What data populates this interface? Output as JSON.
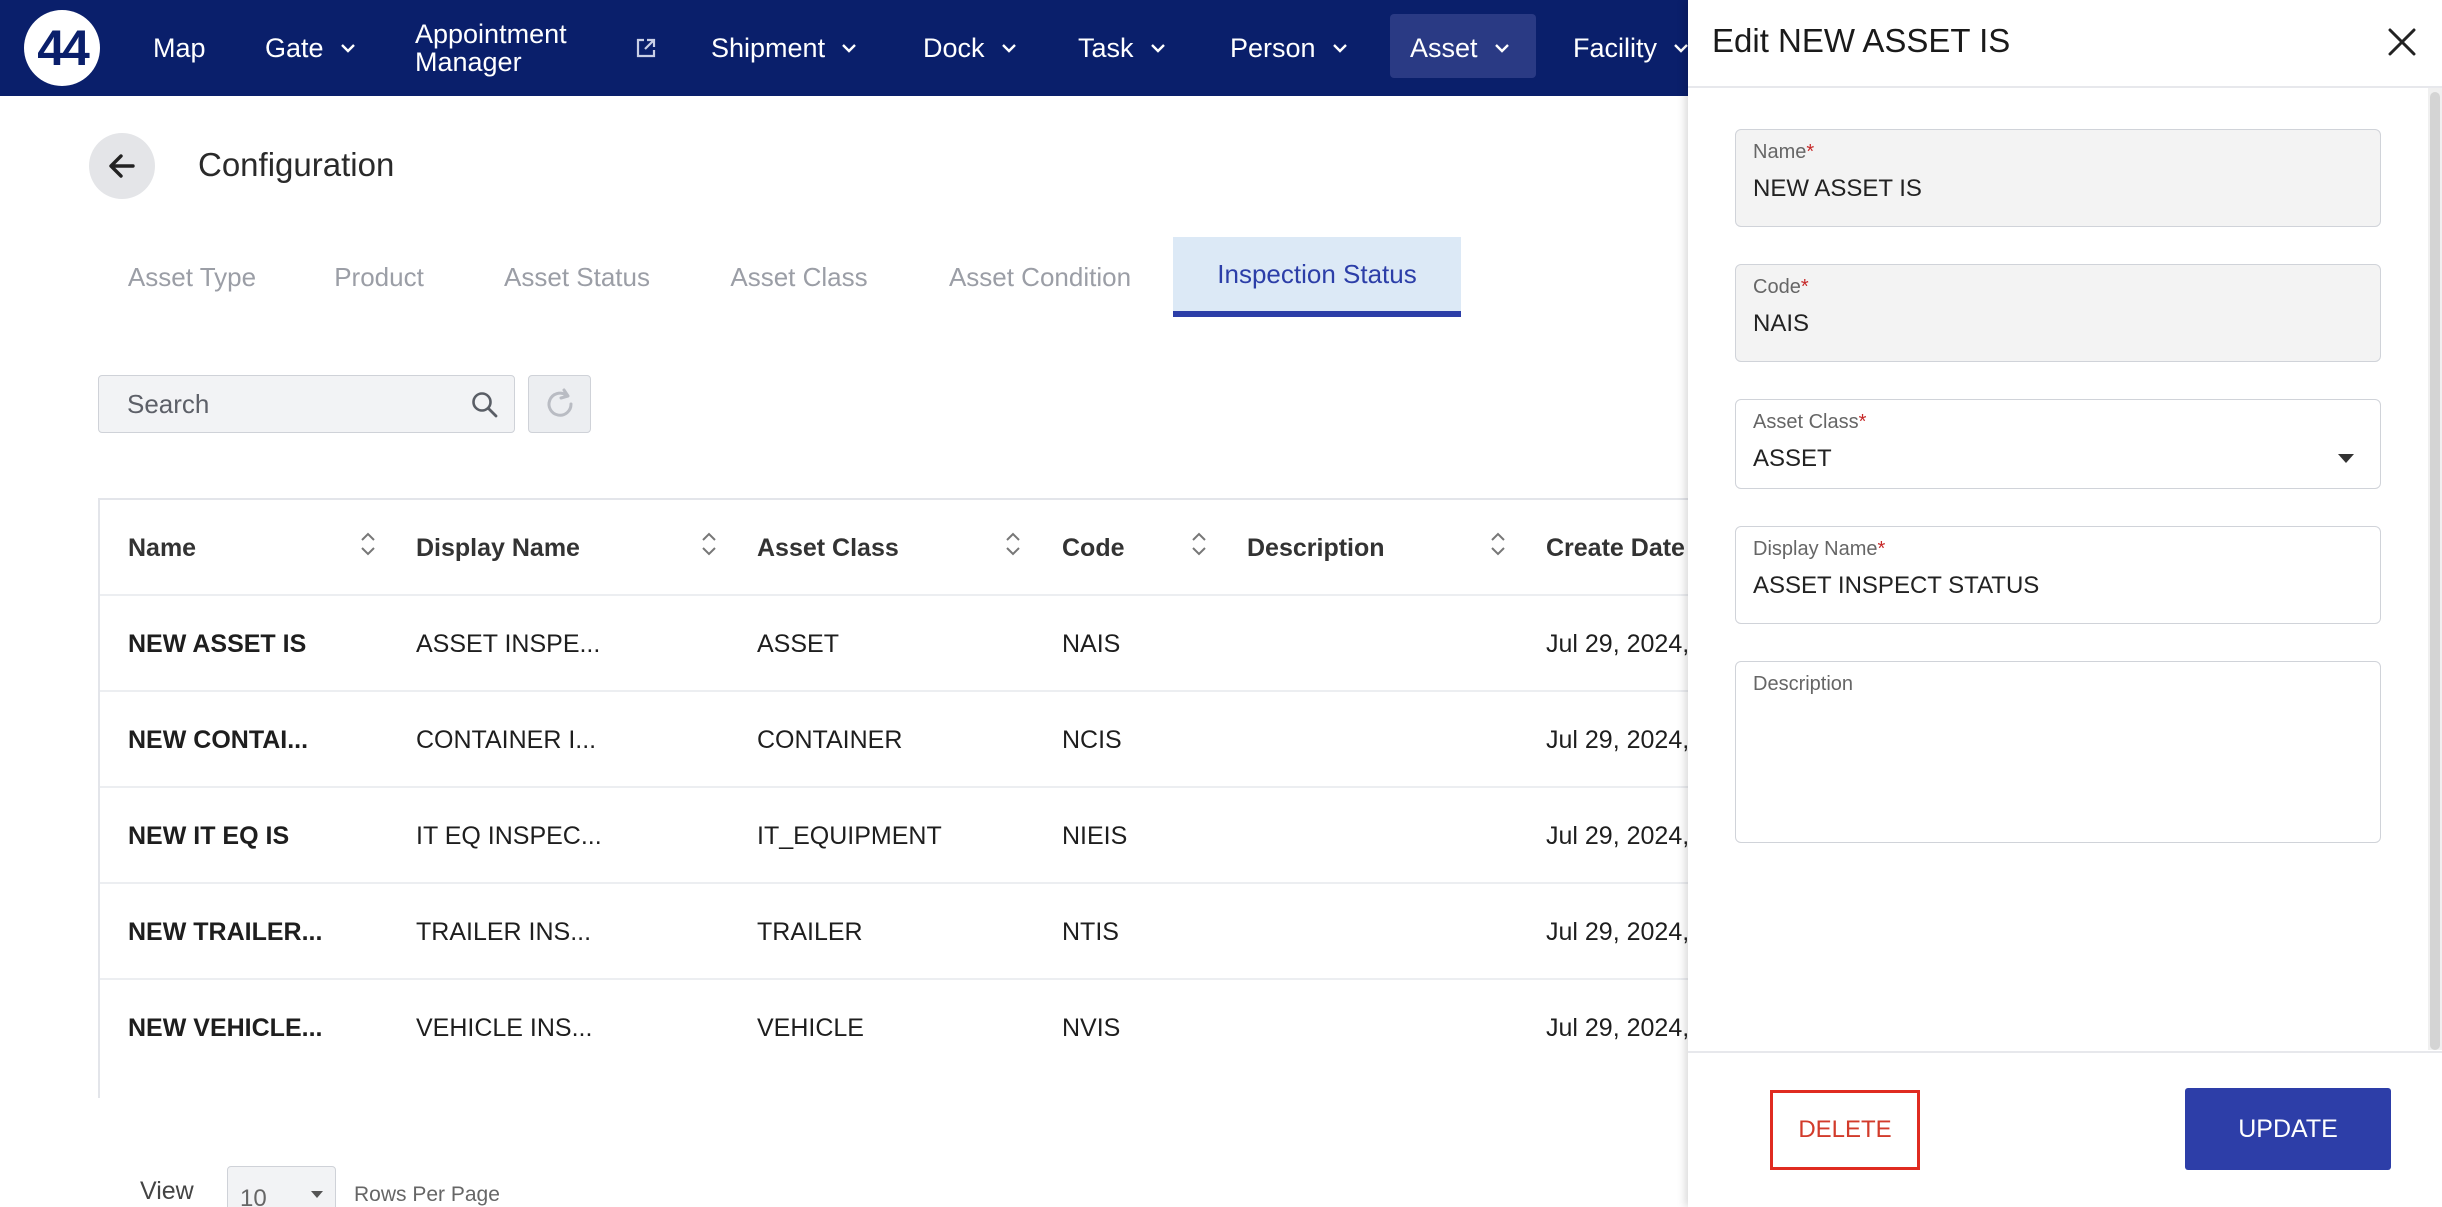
{
  "logo": {
    "text": "44"
  },
  "nav": {
    "items": [
      {
        "label": "Map"
      },
      {
        "label": "Gate"
      },
      {
        "label_line1": "Appointment",
        "label_line2": "Manager"
      },
      {
        "label": "Shipment"
      },
      {
        "label": "Dock"
      },
      {
        "label": "Task"
      },
      {
        "label": "Person"
      },
      {
        "label": "Asset"
      },
      {
        "label": "Facility"
      }
    ],
    "active": "Asset"
  },
  "page": {
    "title": "Configuration"
  },
  "tabs": [
    {
      "label": "Asset Type"
    },
    {
      "label": "Product"
    },
    {
      "label": "Asset Status"
    },
    {
      "label": "Asset Class"
    },
    {
      "label": "Asset Condition"
    },
    {
      "label": "Inspection Status"
    }
  ],
  "active_tab": "Inspection Status",
  "search": {
    "placeholder": "Search"
  },
  "table": {
    "columns": [
      "Name",
      "Display Name",
      "Asset Class",
      "Code",
      "Description",
      "Create Date"
    ],
    "rows": [
      {
        "name": "NEW ASSET IS",
        "display_name": "ASSET INSPE...",
        "asset_class": "ASSET",
        "code": "NAIS",
        "description": "",
        "create_date": "Jul 29, 2024,"
      },
      {
        "name": "NEW CONTAI...",
        "display_name": "CONTAINER I...",
        "asset_class": "CONTAINER",
        "code": "NCIS",
        "description": "",
        "create_date": "Jul 29, 2024,"
      },
      {
        "name": "NEW IT EQ IS",
        "display_name": "IT EQ INSPEC...",
        "asset_class": "IT_EQUIPMENT",
        "code": "NIEIS",
        "description": "",
        "create_date": "Jul 29, 2024,"
      },
      {
        "name": "NEW TRAILER...",
        "display_name": "TRAILER INS...",
        "asset_class": "TRAILER",
        "code": "NTIS",
        "description": "",
        "create_date": "Jul 29, 2024,"
      },
      {
        "name": "NEW VEHICLE...",
        "display_name": "VEHICLE INS...",
        "asset_class": "VEHICLE",
        "code": "NVIS",
        "description": "",
        "create_date": "Jul 29, 2024,"
      }
    ]
  },
  "pagination": {
    "view_label": "View",
    "rows_per_page": "10",
    "rows_label": "Rows Per Page"
  },
  "panel": {
    "title": "Edit NEW ASSET IS",
    "fields": {
      "name": {
        "label": "Name",
        "value": "NEW ASSET IS"
      },
      "code": {
        "label": "Code",
        "value": "NAIS"
      },
      "asset_class": {
        "label": "Asset Class",
        "value": "ASSET"
      },
      "display_name": {
        "label": "Display Name",
        "value": "ASSET INSPECT STATUS"
      },
      "description": {
        "label": "Description",
        "value": ""
      }
    },
    "required_mark": "*",
    "delete_label": "DELETE",
    "update_label": "UPDATE"
  },
  "colors": {
    "nav_bg": "#0a1f6b",
    "accent": "#2d3ea8",
    "delete": "#e02b20",
    "active_tab_bg": "#dce9f6"
  }
}
